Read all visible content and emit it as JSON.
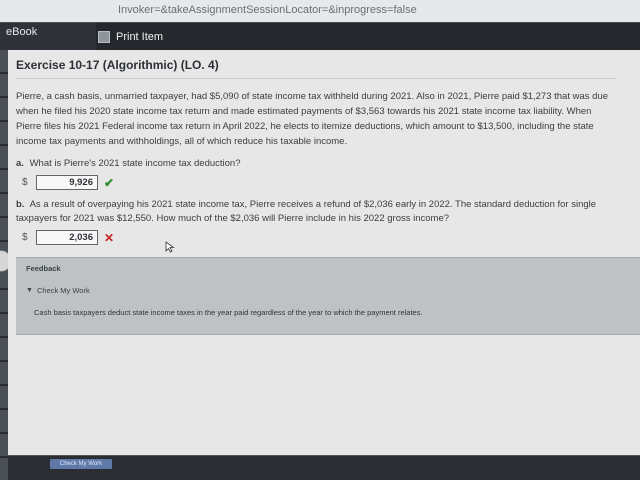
{
  "browser": {
    "url_fragment": "Invoker=&takeAssignmentSessionLocator=&inprogress=false"
  },
  "toolbar": {
    "ebook_label": "eBook",
    "print_label": "Print Item"
  },
  "exercise": {
    "title": "Exercise 10-17 (Algorithmic) (LO. 4)",
    "problem_text": "Pierre, a cash basis, unmarried taxpayer, had $5,090 of state income tax withheld during 2021. Also in 2021, Pierre paid $1,273 that was due when he filed his 2020 state income tax return and made estimated payments of $3,563 towards his 2021 state income tax liability. When Pierre files his 2021 Federal income tax return in April 2022, he elects to itemize deductions, which amount to $13,500, including the state income tax payments and withholdings, all of which reduce his taxable income.",
    "parts": [
      {
        "label": "a.",
        "question": "What is Pierre's 2021 state income tax deduction?",
        "currency": "$",
        "answer": "9,926",
        "status": "correct"
      },
      {
        "label": "b.",
        "question": "As a result of overpaying his 2021 state income tax, Pierre receives a refund of $2,036 early in 2022. The standard deduction for single taxpayers for 2021 was $12,550. How much of the $2,036 will Pierre include in his 2022 gross income?",
        "currency": "$",
        "answer": "2,036",
        "status": "incorrect"
      }
    ]
  },
  "feedback": {
    "title": "Feedback",
    "toggle_label": "Check My Work",
    "text": "Cash basis taxpayers deduct state income taxes in the year paid regardless of the year to which the payment relates."
  },
  "footer": {
    "button_label": "Check My Work"
  },
  "colors": {
    "correct": "#2f8f2f",
    "incorrect": "#c62626"
  }
}
